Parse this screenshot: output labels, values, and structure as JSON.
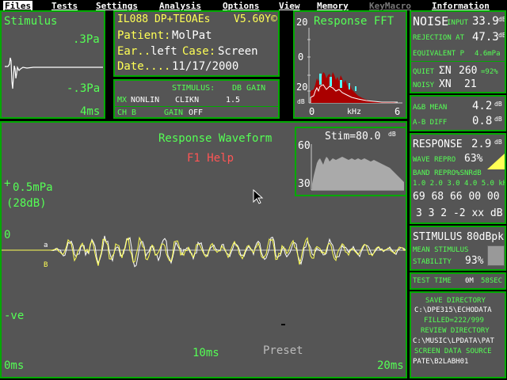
{
  "menu": [
    {
      "label": "Files",
      "state": "selected"
    },
    {
      "label": "Tests",
      "state": "normal"
    },
    {
      "label": "Settings",
      "state": "normal"
    },
    {
      "label": "Analysis",
      "state": "normal"
    },
    {
      "label": "Options",
      "state": "normal"
    },
    {
      "label": "View",
      "state": "normal"
    },
    {
      "label": "Memory",
      "state": "normal"
    },
    {
      "label": "KeyMacro",
      "state": "disabled"
    },
    {
      "label": "Information",
      "state": "normal"
    }
  ],
  "stimulus": {
    "title": "Stimulus",
    "top_scale": ".3Pa",
    "bottom_scale": "-.3Pa",
    "time_label": "4ms"
  },
  "info": {
    "line1": "IL088 DP+TEOAEs",
    "version": "V5.60Y©",
    "patient_label": "Patient:",
    "patient": "MolPat",
    "ear_label": "Ear..",
    "ear": "left",
    "case_label": "Case:",
    "case": "Screen",
    "date_label": "Date....",
    "date": "11/17/2000"
  },
  "settings": {
    "stimulus_label": "STIMULUS:",
    "db_gain_label": "DB GAIN",
    "mx_label": "MX",
    "mx_value": "NONLIN",
    "clikn": "CLIKN",
    "gain_val": "1.5",
    "ch_label": "CH B",
    "gain_label": "GAIN",
    "gain_state": "OFF"
  },
  "fft": {
    "title": "Response FFT",
    "y_top": "20",
    "y_mid": "0",
    "y_bottom": "20",
    "db_unit": "dB",
    "x_start": "0",
    "x_unit": "kHz",
    "x_end": "6"
  },
  "noise": {
    "title": "NOISE",
    "input_label": "INPUT",
    "input_value": "33.9",
    "input_unit": "dB",
    "rejection_label": "REJECTION AT",
    "rejection_value": "47.3",
    "rejection_unit": "dB",
    "equivalent_label": "EQUIVALENT P",
    "equivalent_value": "4.6mPa",
    "quiet_label": "QUIET",
    "quiet_sym": "ΣN",
    "quiet_value": "260",
    "quiet_pct": "=92%",
    "noisy_label": "NOISY",
    "noisy_sym": "XN",
    "noisy_value": "21"
  },
  "ab": {
    "mean_label": "A&B MEAN",
    "mean_value": "4.2",
    "mean_unit": "dB",
    "diff_label": "A-B DIFF",
    "diff_value": "0.8",
    "diff_unit": "dB"
  },
  "response": {
    "title": "RESPONSE",
    "value": "2.9",
    "unit": "dB",
    "wave_repro_label": "WAVE REPRO",
    "wave_repro_value": "63%",
    "band_label": "BAND REPRO%SNRdB",
    "freqs": "1.0 2.0 3.0 4.0 5.0 kHz",
    "repro_values": "69 68 66 00 00 %",
    "snr_values": "3  3  2 -2 xx dB"
  },
  "stim_panel": {
    "title": "STIMULUS",
    "value": "80dBpk",
    "mean_label": "MEAN STIMULUS",
    "stability_label": "STABILITY",
    "stability_value": "93%"
  },
  "test_time": {
    "label": "TEST TIME",
    "minutes": "0M",
    "seconds": "58SEC"
  },
  "directories": {
    "save_label": "SAVE DIRECTORY",
    "save_path": "C:\\DPE315\\ECHODATA",
    "filled": "FILLED=222/999",
    "review_label": "REVIEW DIRECTORY",
    "review_path": "C:\\MUSIC\\LPDATA\\PAT",
    "source_label": "SCREEN DATA SOURCE",
    "source_path": "PATE\\B2LABH01"
  },
  "waveform": {
    "title": "Response Waveform",
    "help": "F1 Help",
    "scale": "0.5mPa",
    "scale_db": "(28dB)",
    "plus": "+",
    "zero": "0",
    "minus": "-ve",
    "a_marker": "a",
    "b_marker": "B",
    "t0": "0ms",
    "t10": "10ms",
    "t20": "20ms",
    "preset": "Preset"
  },
  "stim_spectrum": {
    "title": "Stim=80.0",
    "unit": "dB",
    "y_top": "60",
    "y_bottom": "30"
  },
  "colors": {
    "panel_bg": "#555555",
    "border": "#00aa00",
    "label_green": "#55ff55",
    "wave_yellow": "#ffff55",
    "help_red": "#ff5555",
    "fft_red": "#aa0000",
    "fft_cyan": "#55ffff"
  }
}
